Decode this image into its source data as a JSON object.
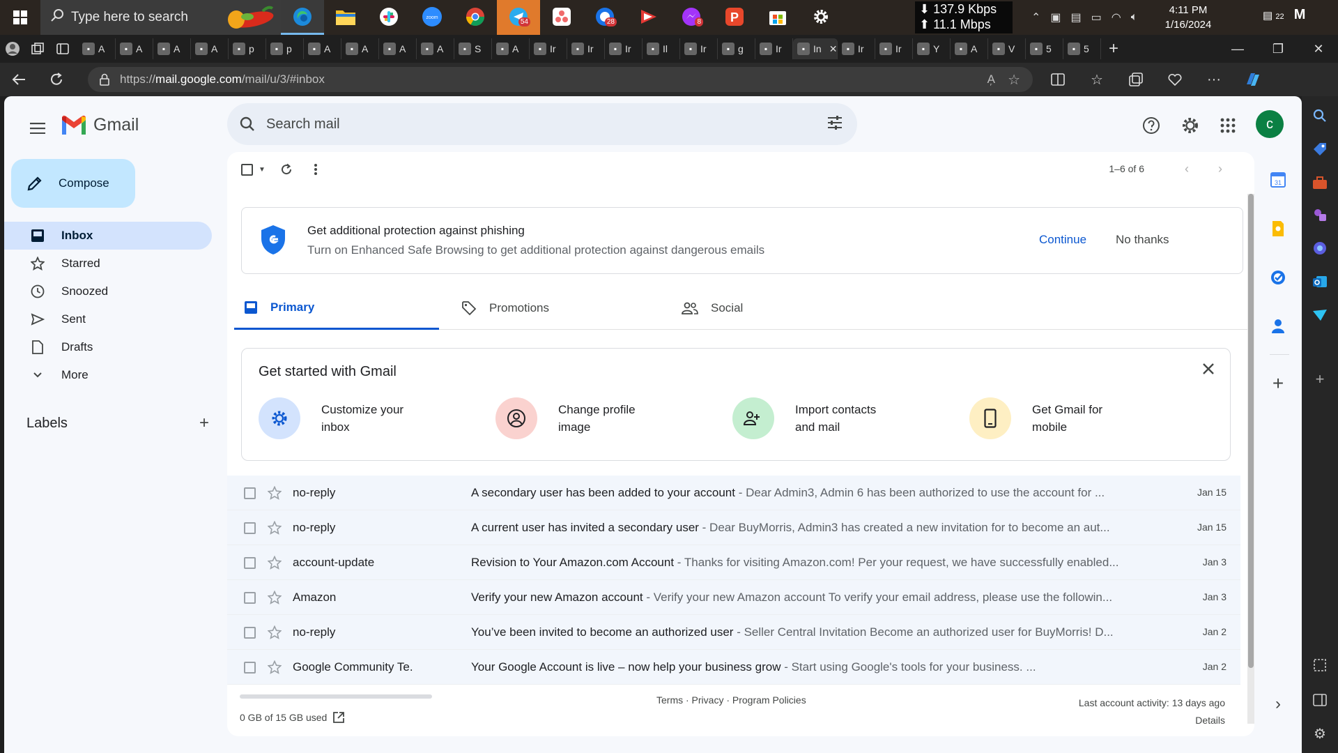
{
  "taskbar": {
    "search_placeholder": "Type here to search",
    "net_down": "⬇ 137.9 Kbps",
    "net_up": "⬆ 11.1 Mbps",
    "time": "4:11 PM",
    "date": "1/16/2024",
    "notif_count": "22",
    "badges": {
      "telegram": "54",
      "app28": "28",
      "messenger": "8"
    }
  },
  "tabs": {
    "letters": [
      "A",
      "A",
      "A",
      "A",
      "p",
      "p",
      "A",
      "A",
      "A",
      "A",
      "S",
      "A",
      "Ir",
      "Ir",
      "Ir",
      "Il",
      "Ir",
      "g",
      "Ir",
      "In",
      "Ir",
      "Ir",
      "Y",
      "A",
      "V",
      "5",
      "5"
    ],
    "active_label": "In"
  },
  "browser": {
    "url_prefix": "https://",
    "url_host": "mail.google.com",
    "url_path": "/mail/u/3/#inbox"
  },
  "gmail": {
    "brand": "Gmail",
    "search_placeholder": "Search mail",
    "avatar_letter": "c",
    "compose_label": "Compose",
    "nav": [
      {
        "label": "Inbox",
        "icon": "inbox-icon"
      },
      {
        "label": "Starred",
        "icon": "star-icon"
      },
      {
        "label": "Snoozed",
        "icon": "clock-icon"
      },
      {
        "label": "Sent",
        "icon": "send-icon"
      },
      {
        "label": "Drafts",
        "icon": "draft-icon"
      },
      {
        "label": "More",
        "icon": "chevron-down-icon"
      }
    ],
    "labels_heading": "Labels",
    "pager": "1–6 of 6",
    "banner": {
      "title": "Get additional protection against phishing",
      "body": "Turn on Enhanced Safe Browsing to get additional protection against dangerous emails",
      "continue": "Continue",
      "no_thanks": "No thanks"
    },
    "tabs": [
      {
        "label": "Primary"
      },
      {
        "label": "Promotions"
      },
      {
        "label": "Social"
      }
    ],
    "get_started": {
      "title": "Get started with Gmail",
      "cards": [
        {
          "l1": "Customize your",
          "l2": "inbox"
        },
        {
          "l1": "Change profile",
          "l2": "image"
        },
        {
          "l1": "Import contacts",
          "l2": "and mail"
        },
        {
          "l1": "Get Gmail for",
          "l2": "mobile"
        }
      ]
    },
    "emails": [
      {
        "sender": "no-reply",
        "subject": "A secondary user has been added to your account",
        "snippet": " - Dear Admin3, Admin 6 has been authorized to use the account for ...",
        "date": "Jan 15"
      },
      {
        "sender": "no-reply",
        "subject": "A current user has invited a secondary user",
        "snippet": " - Dear BuyMorris, Admin3 has created a new invitation for to become an aut...",
        "date": "Jan 15"
      },
      {
        "sender": "account-update",
        "subject": "Revision to Your Amazon.com Account",
        "snippet": " - Thanks for visiting Amazon.com! Per your request, we have successfully enabled...",
        "date": "Jan 3"
      },
      {
        "sender": "Amazon",
        "subject": "Verify your new Amazon account",
        "snippet": " - Verify your new Amazon account To verify your email address, please use the followin...",
        "date": "Jan 3"
      },
      {
        "sender": "no-reply",
        "subject": "You’ve been invited to become an authorized user",
        "snippet": " - Seller Central Invitation Become an authorized user for BuyMorris! D...",
        "date": "Jan 2"
      },
      {
        "sender": "Google Community Te.",
        "subject": "Your Google Account is live – now help your business grow",
        "snippet": " - Start using Google's tools for your business.        ...",
        "date": "Jan 2"
      }
    ],
    "footer": {
      "storage": "0 GB of 15 GB used",
      "links": "Terms · Privacy · Program Policies",
      "activity": "Last account activity: 13 days ago",
      "details": "Details"
    }
  },
  "colors": {
    "accent": "#0b57d0",
    "compose_bg": "#c2e7ff",
    "inbox_active": "#d3e3fd",
    "avatar": "#0b8043"
  }
}
